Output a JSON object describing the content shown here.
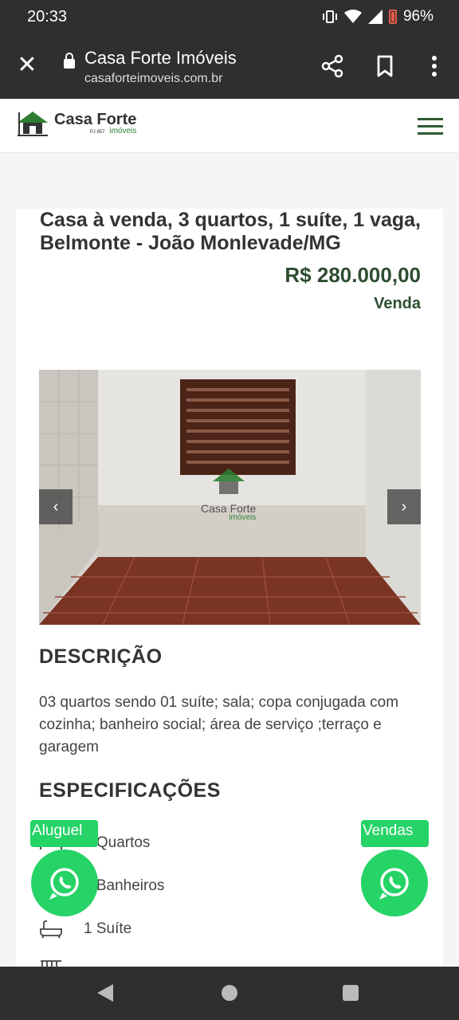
{
  "status": {
    "time": "20:33",
    "battery": "96%"
  },
  "browser": {
    "title": "Casa Forte Imóveis",
    "url": "casaforteimoveis.com.br"
  },
  "site": {
    "logo_main": "Casa Forte",
    "logo_sub": "imóveis",
    "logo_pj": "PJ 857"
  },
  "listing": {
    "title": "Casa à venda, 3 quartos, 1 suíte, 1 vaga, Belmonte - João Monlevade/MG",
    "price": "R$ 280.000,00",
    "type": "Venda",
    "watermark_main": "Casa Forte",
    "watermark_sub": "imóveis"
  },
  "description": {
    "heading": "DESCRIÇÃO",
    "text": "03 quartos sendo 01 suíte; sala; copa conjugada com cozinha; banheiro social; área de serviço ;terraço e garagem"
  },
  "specs": {
    "heading": "ESPECIFICAÇÕES",
    "items": [
      {
        "icon": "bed-icon",
        "label": "3 Quartos"
      },
      {
        "icon": "shower-icon",
        "label": "2 Banheiros"
      },
      {
        "icon": "bathtub-icon",
        "label": "1 Suíte"
      }
    ]
  },
  "whatsapp": {
    "rent_label": "Aluguel",
    "sales_label": "Vendas"
  },
  "colors": {
    "brand_green": "#2e4d31",
    "whatsapp_green": "#25d366",
    "system_bar": "#2f2f2f"
  }
}
